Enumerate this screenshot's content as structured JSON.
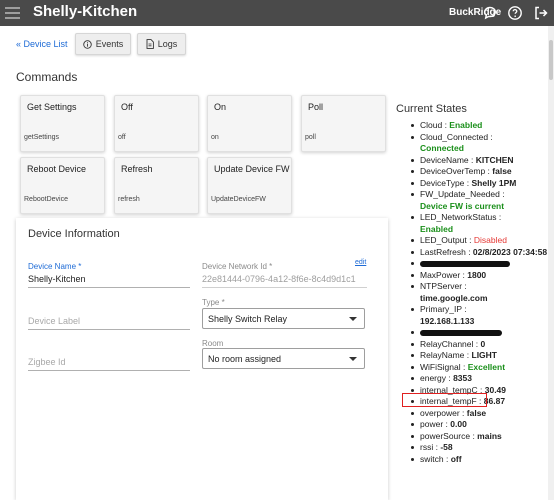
{
  "header": {
    "title": "Shelly-Kitchen",
    "hub_name": "BuckRidge"
  },
  "nav": {
    "device_list": "« Device List",
    "events": "Events",
    "logs": "Logs"
  },
  "commands": {
    "title": "Commands",
    "items": [
      {
        "name": "Get Settings",
        "method": "getSettings"
      },
      {
        "name": "Off",
        "method": "off"
      },
      {
        "name": "On",
        "method": "on"
      },
      {
        "name": "Poll",
        "method": "poll"
      },
      {
        "name": "Reboot Device",
        "method": "RebootDevice"
      },
      {
        "name": "Refresh",
        "method": "refresh"
      },
      {
        "name": "Update Device FW",
        "method": "UpdateDeviceFW"
      }
    ]
  },
  "device_info": {
    "title": "Device Information",
    "device_name_label": "Device Name *",
    "device_name_value": "Shelly-Kitchen",
    "network_id_label": "Device Network Id *",
    "network_id_value": "22e81444-0796-4a12-8f6e-8c4d9d1c1",
    "edit_link": "edit",
    "device_label_placeholder": "Device Label",
    "type_label": "Type *",
    "type_value": "Shelly Switch Relay",
    "zigbee_placeholder": "Zigbee Id",
    "room_label": "Room",
    "room_value": "No room assigned"
  },
  "current_states": {
    "title": "Current States",
    "cloud_key": "Cloud : ",
    "cloud_val": "Enabled",
    "cloud_connected_key": "Cloud_Connected :",
    "cloud_connected_val": "Connected",
    "device_name_key": "DeviceName : ",
    "device_name_val": "KITCHEN",
    "over_temp_key": "DeviceOverTemp : ",
    "over_temp_val": "false",
    "device_type_key": "DeviceType : ",
    "device_type_val": "Shelly 1PM",
    "fw_key": "FW_Update_Needed :",
    "fw_val": "Device FW is current",
    "led_net_key": "LED_NetworkStatus :",
    "led_net_val": "Enabled",
    "led_out_key": "LED_Output : ",
    "led_out_val": "Disabled",
    "last_refresh_key": "LastRefresh : ",
    "last_refresh_val": "02/8/2023 07:34:58",
    "max_power_key": "MaxPower : ",
    "max_power_val": "1800",
    "ntp_key": "NTPServer :",
    "ntp_val": "time.google.com",
    "ip_key": "Primary_IP :",
    "ip_val": "192.168.1.133",
    "relay_channel_key": "RelayChannel : ",
    "relay_channel_val": "0",
    "relay_name_key": "RelayName : ",
    "relay_name_val": "LIGHT",
    "wifi_key": "WiFiSignal : ",
    "wifi_val": "Excellent",
    "energy_key": "energy : ",
    "energy_val": "8353",
    "temp_c_key": "internal_tempC : ",
    "temp_c_val": "30.49",
    "temp_f_key": "internal_tempF : ",
    "temp_f_val": "86.87",
    "overpower_key": "overpower : ",
    "overpower_val": "false",
    "power_key": "power : ",
    "power_val": "0.00",
    "power_source_key": "powerSource : ",
    "power_source_val": "mains",
    "rssi_key": "rssi : ",
    "rssi_val": "-58",
    "switch_key": "switch : ",
    "switch_val": "off"
  },
  "colors": {
    "topbar": "#4a4a4a",
    "link": "#1e6bd6",
    "enabled": "#1a8f1a",
    "disabled": "#e53935",
    "highlight": "#e02020"
  }
}
